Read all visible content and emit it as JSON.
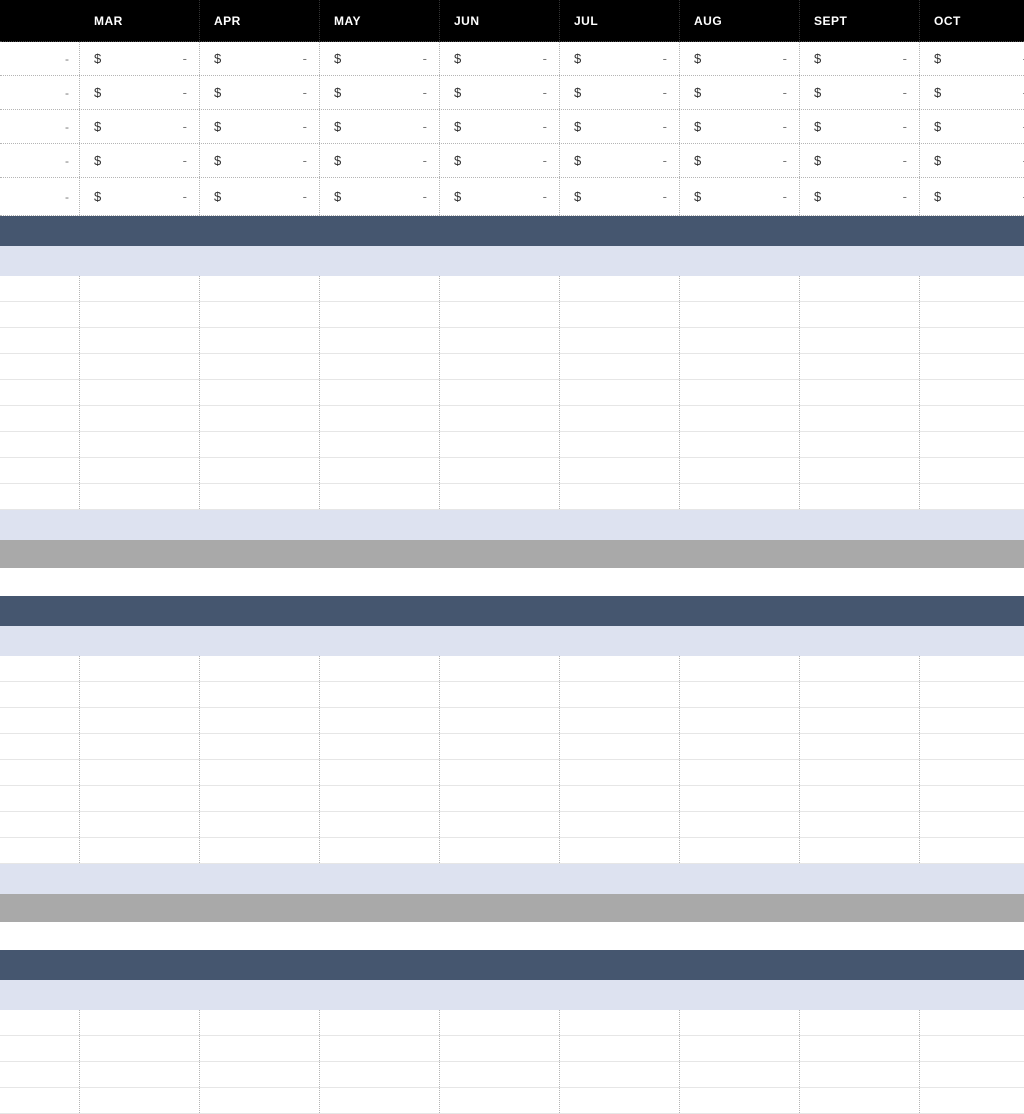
{
  "colors": {
    "header_bg": "#000000",
    "band_dark": "#45566f",
    "band_light": "#dde2f0",
    "band_gray": "#a9a9a9"
  },
  "columns": [
    "MAR",
    "APR",
    "MAY",
    "JUN",
    "JUL",
    "AUG",
    "SEPT",
    "OCT"
  ],
  "currency_symbol": "$",
  "placeholder_value": "-",
  "data_rows": [
    {
      "lead": "-",
      "cells": [
        "$",
        "$",
        "$",
        "$",
        "$",
        "$",
        "$",
        "$"
      ]
    },
    {
      "lead": "-",
      "cells": [
        "$",
        "$",
        "$",
        "$",
        "$",
        "$",
        "$",
        "$"
      ]
    },
    {
      "lead": "-",
      "cells": [
        "$",
        "$",
        "$",
        "$",
        "$",
        "$",
        "$",
        "$"
      ]
    },
    {
      "lead": "-",
      "cells": [
        "$",
        "$",
        "$",
        "$",
        "$",
        "$",
        "$",
        "$"
      ]
    },
    {
      "lead": "-",
      "cells": [
        "$",
        "$",
        "$",
        "$",
        "$",
        "$",
        "$",
        "$"
      ]
    }
  ],
  "section1_grid_rows": 9,
  "section2_grid_rows": 8,
  "section3_grid_rows": 4
}
